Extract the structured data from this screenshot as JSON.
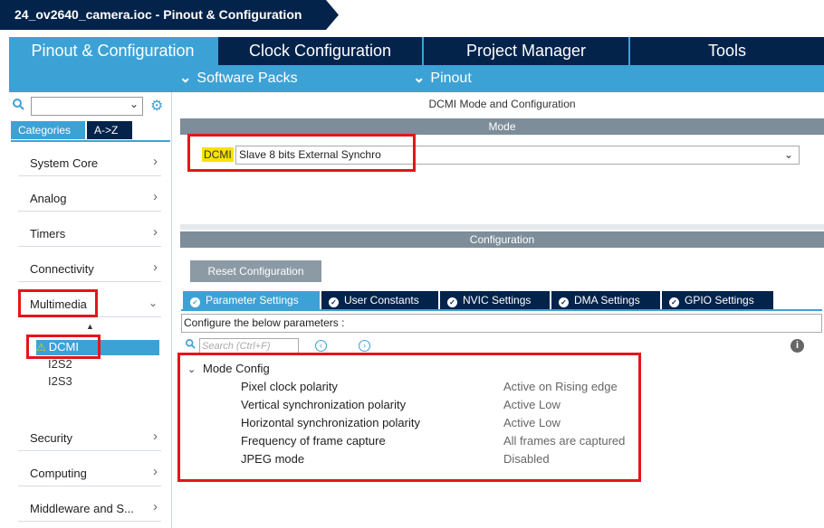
{
  "breadcrumb": {
    "file": "24_ov2640_camera.ioc - Pinout & Configuration"
  },
  "main_tabs": [
    {
      "label": "Pinout & Configuration",
      "active": true
    },
    {
      "label": "Clock Configuration",
      "active": false
    },
    {
      "label": "Project Manager",
      "active": false
    },
    {
      "label": "Tools",
      "active": false
    }
  ],
  "sub_tabs": [
    {
      "label": "Software Packs"
    },
    {
      "label": "Pinout"
    }
  ],
  "sidebar": {
    "search_placeholder": "",
    "tab_categories": "Categories",
    "tab_az": "A->Z",
    "categories": [
      {
        "label": "System Core"
      },
      {
        "label": "Analog"
      },
      {
        "label": "Timers"
      },
      {
        "label": "Connectivity"
      },
      {
        "label": "Multimedia"
      },
      {
        "label": "Security"
      },
      {
        "label": "Computing"
      },
      {
        "label": "Middleware and S..."
      }
    ],
    "multimedia_items": [
      {
        "label": "DCMI",
        "selected": true,
        "warning": true
      },
      {
        "label": "I2S2",
        "selected": false
      },
      {
        "label": "I2S3",
        "selected": false
      }
    ]
  },
  "panel": {
    "title": "DCMI Mode and Configuration",
    "mode_header": "Mode",
    "mode_label": "DCMI",
    "mode_value": "Slave 8 bits External Synchro",
    "config_header": "Configuration",
    "reset_button": "Reset Configuration",
    "config_tabs": [
      {
        "label": "Parameter Settings",
        "active": true
      },
      {
        "label": "User Constants",
        "active": false
      },
      {
        "label": "NVIC Settings",
        "active": false
      },
      {
        "label": "DMA Settings",
        "active": false
      },
      {
        "label": "GPIO Settings",
        "active": false
      }
    ],
    "configure_text": "Configure the below parameters :",
    "search_placeholder": "Search (Ctrl+F)",
    "group": "Mode Config",
    "params": [
      {
        "name": "Pixel clock polarity",
        "value": "Active on Rising edge"
      },
      {
        "name": "Vertical synchronization polarity",
        "value": "Active Low"
      },
      {
        "name": "Horizontal synchronization polarity",
        "value": "Active Low"
      },
      {
        "name": "Frequency of frame capture",
        "value": "All frames are captured"
      },
      {
        "name": "JPEG mode",
        "value": "Disabled"
      }
    ]
  },
  "colors": {
    "navy": "#03234b",
    "accent": "#3ca2d6",
    "highlight": "#e5141b",
    "mode_label_bg": "#f7e200"
  }
}
